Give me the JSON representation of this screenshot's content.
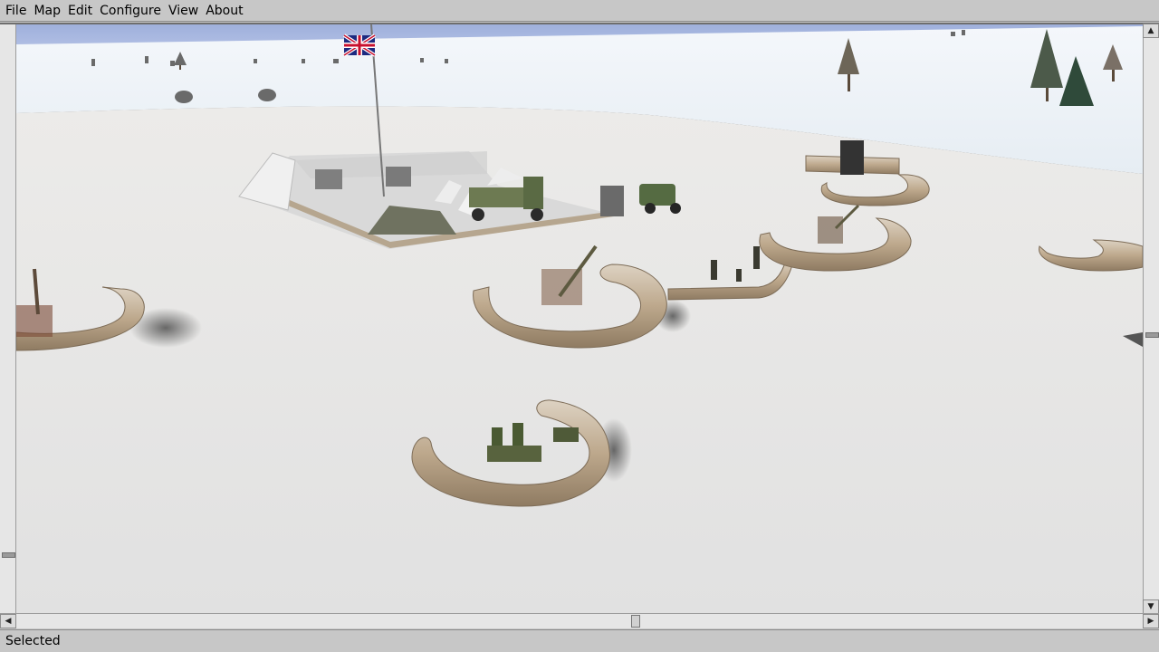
{
  "menubar": {
    "items": [
      "File",
      "Map",
      "Edit",
      "Configure",
      "View",
      "About"
    ]
  },
  "status": {
    "text": "Selected"
  },
  "colors": {
    "sky": "#a9b8e0",
    "snow": "#e4e4e4",
    "sandbag": "#cbb9a0",
    "flag_blue": "#1d2a80",
    "flag_red": "#c8102e"
  }
}
